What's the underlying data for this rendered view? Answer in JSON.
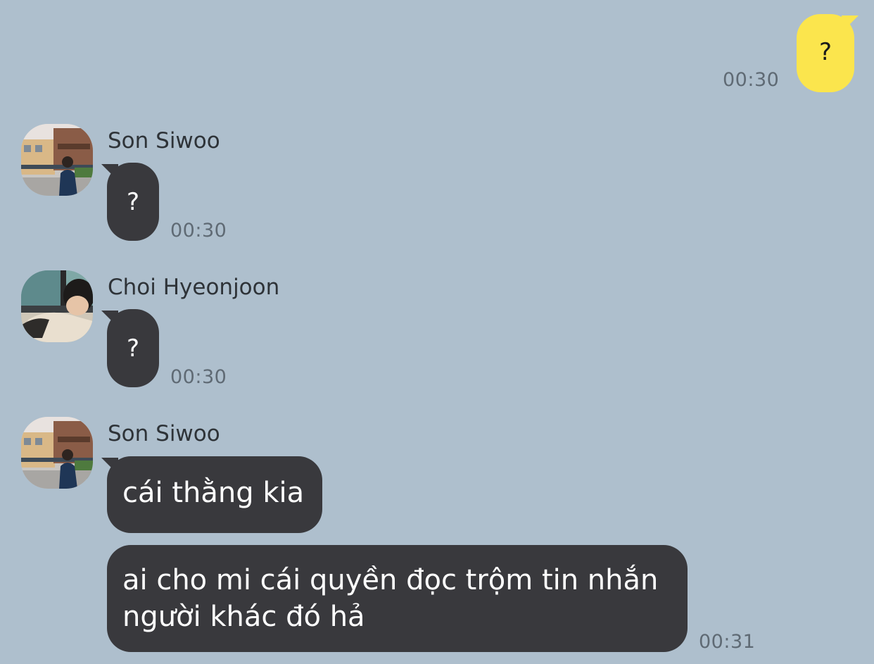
{
  "messages": [
    {
      "sender": "",
      "text": "?",
      "time": "00:30",
      "outgoing": true
    },
    {
      "sender": "Son Siwoo",
      "text": "?",
      "time": "00:30"
    },
    {
      "sender": "Choi Hyeonjoon",
      "text": "?",
      "time": "00:30"
    },
    {
      "sender": "Son Siwoo",
      "text": "cái thằng kia"
    },
    {
      "sender": "Son Siwoo",
      "text": "ai cho mi cái quyền đọc trộm tin nhắn\nngười khác đó hả",
      "time": "00:31"
    }
  ],
  "colors": {
    "background": "#aebfcd",
    "incoming_bubble": "#39393d",
    "outgoing_bubble": "#fbe54d",
    "timestamp": "#5f6a74"
  }
}
